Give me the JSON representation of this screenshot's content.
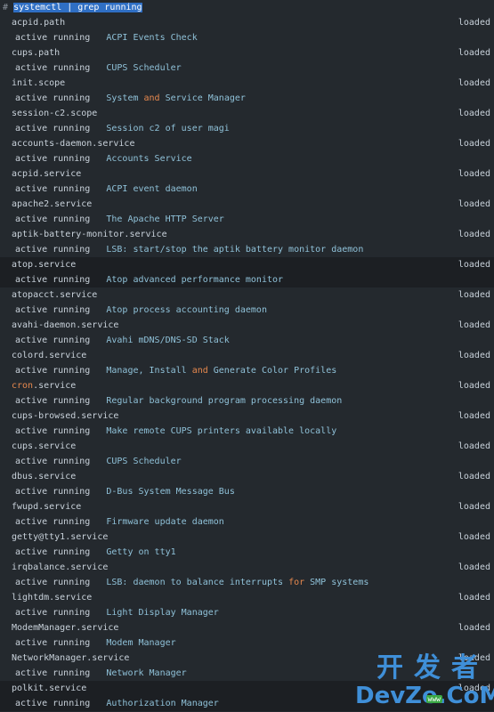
{
  "terminal": {
    "prompt": "#",
    "command": "systemctl | grep running"
  },
  "status_text": "active running",
  "loaded_text": "loaded",
  "units": [
    {
      "name": "acpid.path",
      "desc": "ACPI Events Check"
    },
    {
      "name": "cups.path",
      "desc": "CUPS Scheduler"
    },
    {
      "name": "init.scope",
      "desc_a": "System ",
      "desc_kw": "and",
      "desc_b": " Service Manager"
    },
    {
      "name": "session-c2.scope",
      "desc": "Session c2 of user magi"
    },
    {
      "name": "accounts-daemon.service",
      "desc": "Accounts Service"
    },
    {
      "name": "acpid.service",
      "desc": "ACPI event daemon"
    },
    {
      "name": "apache2.service",
      "desc": "The Apache HTTP Server"
    },
    {
      "name": "aptik-battery-monitor.service",
      "desc": "LSB: start/stop the aptik battery monitor daemon"
    },
    {
      "name": "atop.service",
      "desc": "Atop advanced performance monitor"
    },
    {
      "name": "atopacct.service",
      "desc": "Atop process accounting daemon"
    },
    {
      "name": "avahi-daemon.service",
      "desc": "Avahi mDNS/DNS-SD Stack"
    },
    {
      "name": "colord.service",
      "desc_a": "Manage, Install ",
      "desc_kw": "and",
      "desc_b": " Generate Color Profiles"
    },
    {
      "name_a": "cron",
      "name_b": ".service",
      "desc": "Regular background program processing daemon"
    },
    {
      "name": "cups-browsed.service",
      "desc": "Make remote CUPS printers available locally"
    },
    {
      "name": "cups.service",
      "desc": "CUPS Scheduler"
    },
    {
      "name": "dbus.service",
      "desc": "D-Bus System Message Bus"
    },
    {
      "name": "fwupd.service",
      "desc": "Firmware update daemon"
    },
    {
      "name": "getty@tty1.service",
      "desc": "Getty on tty1"
    },
    {
      "name": "irqbalance.service",
      "desc_a": "LSB: daemon to balance interrupts ",
      "desc_kw": "for",
      "desc_b": " SMP systems"
    },
    {
      "name": "lightdm.service",
      "desc": "Light Display Manager"
    },
    {
      "name": "ModemManager.service",
      "desc": "Modem Manager"
    },
    {
      "name": "NetworkManager.service",
      "desc": "Network Manager"
    },
    {
      "name": "polkit.service",
      "desc": "Authorization Manager"
    }
  ],
  "watermark": {
    "top": "开发者",
    "bottom": "DevZe.CoM",
    "badge": "www"
  },
  "colors": {
    "background": "#24292e",
    "selection": "#2f6fc4",
    "description": "#8fc1d8",
    "keyword": "#e6884e"
  }
}
